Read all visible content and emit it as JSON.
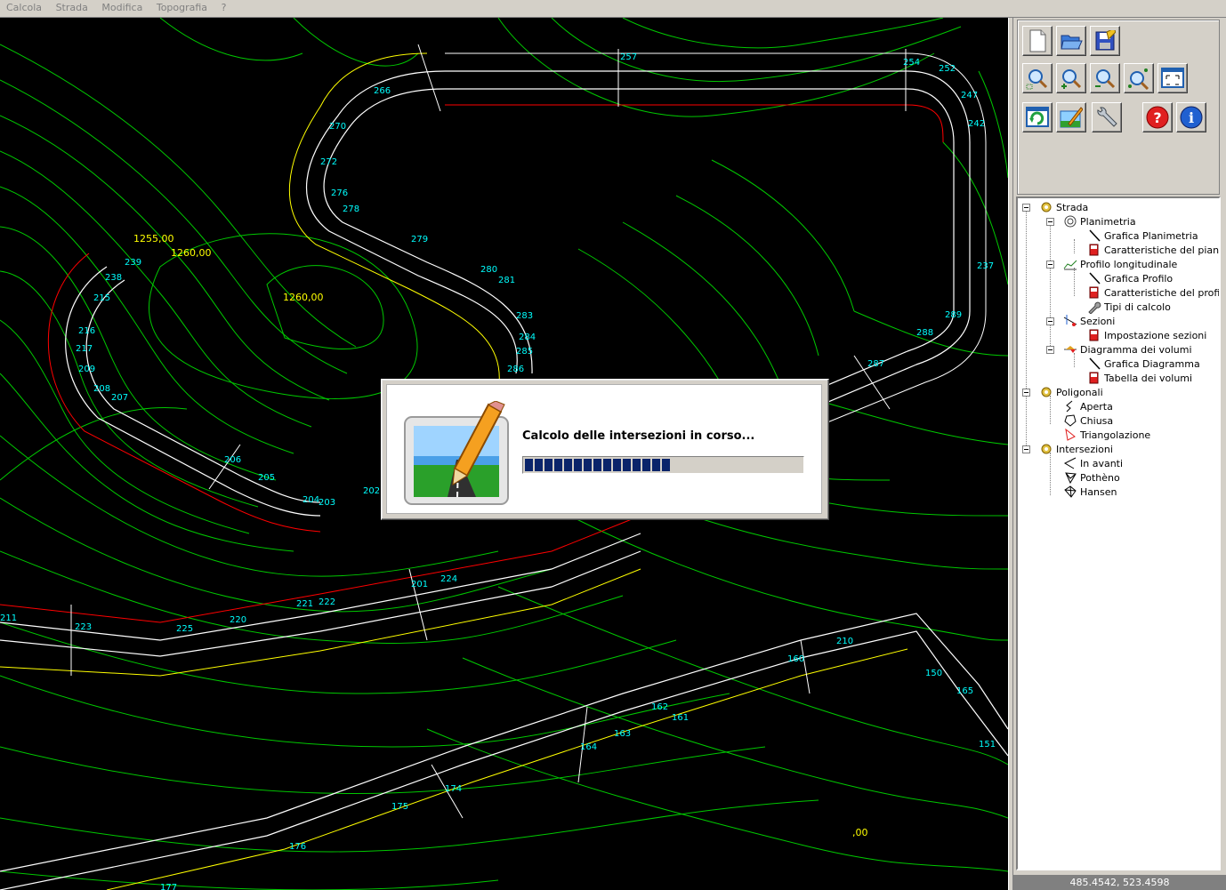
{
  "menu": [
    "Calcola",
    "Strada",
    "Modifica",
    "Topografia",
    "?"
  ],
  "canvas": {
    "labels_yellow": [
      "1255,00",
      "1260,00",
      "1260,00",
      ",00"
    ],
    "labels_cyan": [
      "257",
      "254",
      "252",
      "247",
      "242",
      "266",
      "270",
      "272",
      "276",
      "278",
      "279",
      "280",
      "281",
      "283",
      "284",
      "285",
      "286",
      "287",
      "288",
      "289",
      "237",
      "238",
      "239",
      "215",
      "216",
      "217",
      "209",
      "208",
      "207",
      "206",
      "205",
      "204",
      "203",
      "202",
      "201",
      "224",
      "225",
      "220",
      "221",
      "222",
      "223",
      "211",
      "210",
      "160",
      "161",
      "162",
      "163",
      "164",
      "165",
      "150",
      "151",
      "174",
      "175",
      "176",
      "177"
    ]
  },
  "toolbar": {
    "row1": [
      "new-file-icon",
      "open-folder-icon",
      "save-icon"
    ],
    "row2": [
      "zoom-window-icon",
      "zoom-in-icon",
      "zoom-out-icon",
      "zoom-dynamic-icon",
      "zoom-extents-icon"
    ],
    "row3": [
      "refresh-icon",
      "edit-image-icon",
      "settings-wrench-icon",
      "help-icon",
      "info-icon"
    ]
  },
  "tree": {
    "strada": "Strada",
    "planimetria": "Planimetria",
    "grafica_planimetria": "Grafica Planimetria",
    "caratteristiche_piano": "Caratteristiche del piano",
    "profilo_longitudinale": "Profilo longitudinale",
    "grafica_profilo": "Grafica Profilo",
    "caratteristiche_profilo": "Caratteristiche del profilo",
    "tipi_calcolo": "Tipi di calcolo",
    "sezioni": "Sezioni",
    "impostazione_sezioni": "Impostazione sezioni",
    "diagramma_volumi": "Diagramma dei volumi",
    "grafica_diagramma": "Grafica Diagramma",
    "tabella_volumi": "Tabella dei volumi",
    "poligonali": "Poligonali",
    "aperta": "Aperta",
    "chiusa": "Chiusa",
    "triangolazione": "Triangolazione",
    "intersezioni": "Intersezioni",
    "in_avanti": "In avanti",
    "pothenot": "Pothèno",
    "hansen": "Hansen"
  },
  "status": {
    "coordinates": "485.4542,  523.4598"
  },
  "dialog": {
    "message": "Calcolo delle intersezioni in corso...",
    "progress": 0.54
  },
  "colors": {
    "contour": "#00c800",
    "road": "#ffffff",
    "label": "#00ffff",
    "edge_red": "#ff0000",
    "edge_yellow": "#ffff00",
    "progress": "#0a246a"
  }
}
